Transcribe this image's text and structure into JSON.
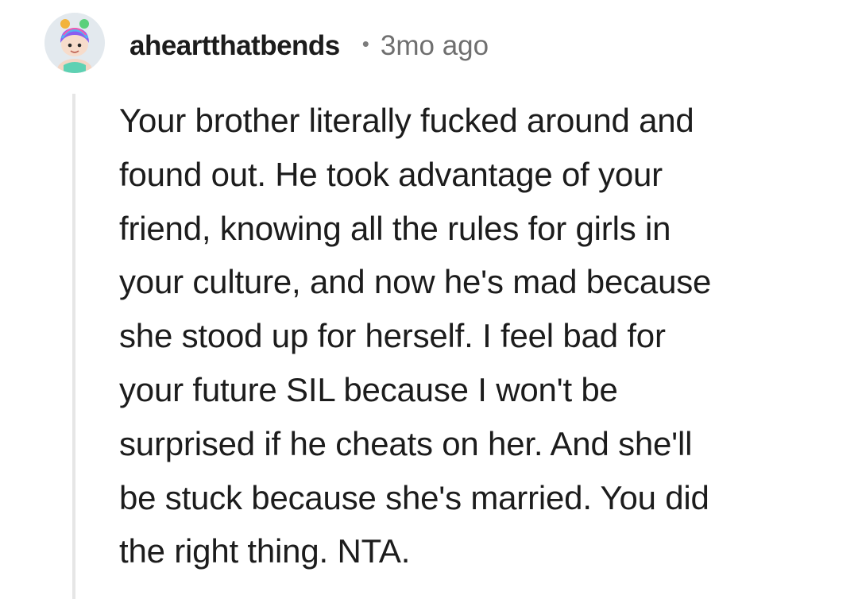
{
  "comment": {
    "author": {
      "username": "aheartthatbends",
      "avatar_icon": "snoo-avatar-icon"
    },
    "separator": "•",
    "timestamp": "3mo ago",
    "body": "Your brother literally fucked around and\nfound out. He took advantage of your\nfriend, knowing all the rules for girls in\nyour culture, and now he's mad because\nshe stood up for herself. I feel bad for\nyour future SIL because I won't be\nsurprised if he cheats on her. And she'll\nbe stuck because she's married. You did\nthe right thing. NTA."
  },
  "colors": {
    "text": "#1c1c1c",
    "meta": "#6f6f6f",
    "thread_line": "#e6e6e6",
    "background": "#ffffff"
  }
}
